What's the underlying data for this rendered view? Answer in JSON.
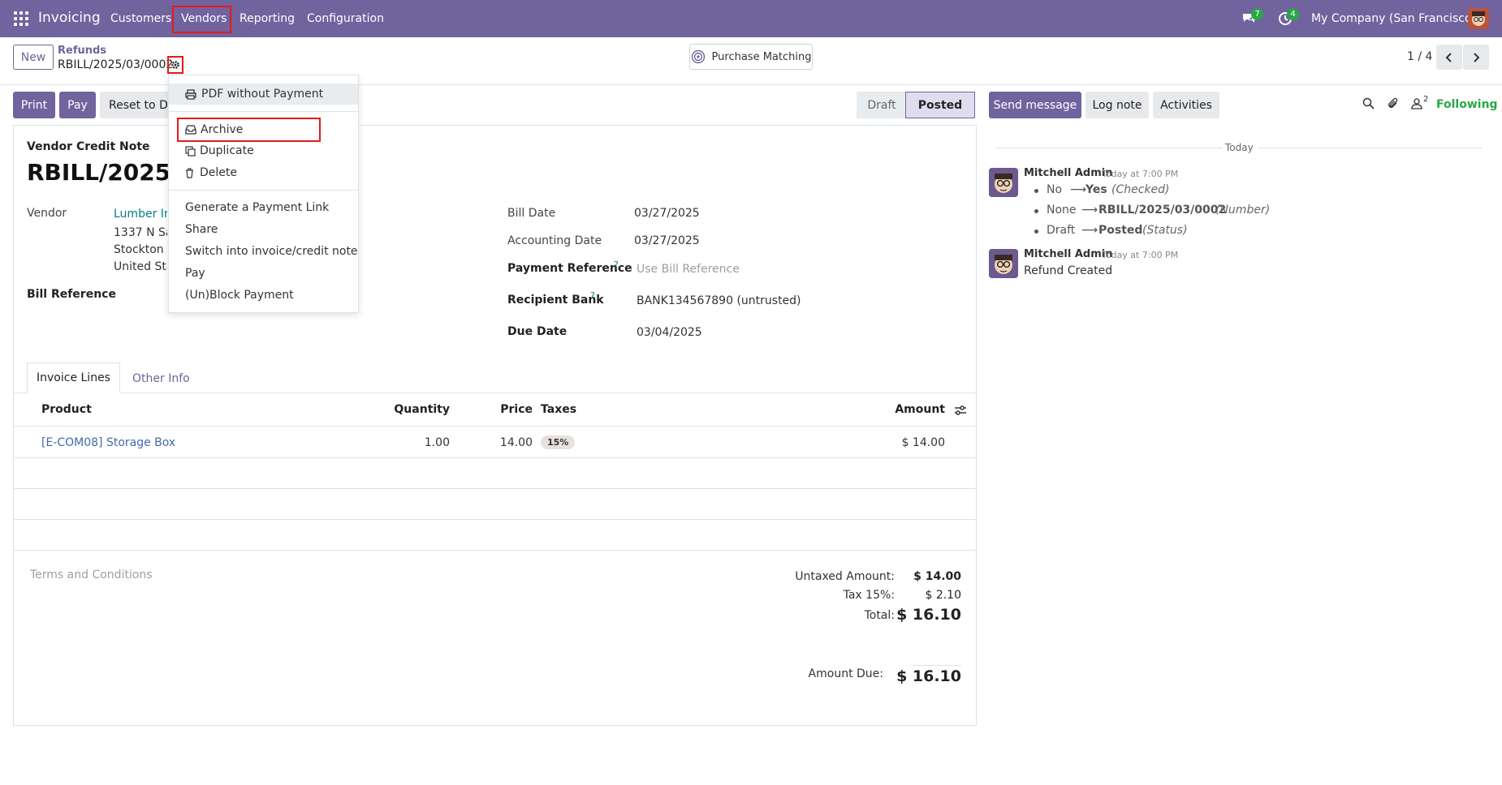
{
  "navbar": {
    "app_name": "Invoicing",
    "menu": [
      "Customers",
      "Vendors",
      "Reporting",
      "Configuration"
    ],
    "messages_count": "7",
    "activities_count": "4",
    "company": "My Company (San Francisco)"
  },
  "control": {
    "new_label": "New",
    "breadcrumb_parent": "Refunds",
    "breadcrumb_current": "RBILL/2025/03/0002",
    "smart_button": "Purchase Matching",
    "pager": "1 / 4"
  },
  "actions": {
    "print": "Print",
    "pay": "Pay",
    "reset": "Reset to Dr"
  },
  "status": {
    "draft": "Draft",
    "posted": "Posted"
  },
  "dropdown": {
    "pdf": "PDF without Payment",
    "archive": "Archive",
    "duplicate": "Duplicate",
    "delete": "Delete",
    "payment_link": "Generate a Payment Link",
    "share": "Share",
    "switch": "Switch into invoice/credit note",
    "pay": "Pay",
    "block": "(Un)Block Payment"
  },
  "form": {
    "doc_type": "Vendor Credit Note",
    "doc_number": "RBILL/2025/03/0",
    "vendor_label": "Vendor",
    "vendor_name": "Lumber Inc",
    "vendor_addr1": "1337 N Sar",
    "vendor_addr2": "Stockton C",
    "vendor_addr3": "United Sta",
    "bill_ref_label": "Bill Reference",
    "bill_date_label": "Bill Date",
    "bill_date": "03/27/2025",
    "acc_date_label": "Accounting Date",
    "acc_date": "03/27/2025",
    "pay_ref_label": "Payment Reference",
    "pay_ref_placeholder": "Use Bill Reference",
    "bank_label": "Recipient Bank",
    "bank": "BANK134567890 (untrusted)",
    "due_label": "Due Date",
    "due_date": "03/04/2025",
    "help": "?"
  },
  "tabs": {
    "lines": "Invoice Lines",
    "other": "Other Info"
  },
  "table": {
    "headers": {
      "product": "Product",
      "quantity": "Quantity",
      "price": "Price",
      "taxes": "Taxes",
      "amount": "Amount"
    },
    "rows": [
      {
        "product": "[E-COM08] Storage Box",
        "quantity": "1.00",
        "price": "14.00",
        "tax": "15%",
        "amount": "$ 14.00"
      }
    ]
  },
  "totals": {
    "terms_placeholder": "Terms and Conditions",
    "untaxed_label": "Untaxed Amount:",
    "untaxed": "$ 14.00",
    "tax_label": "Tax 15%:",
    "tax": "$ 2.10",
    "total_label": "Total:",
    "total": "$ 16.10",
    "due_label": "Amount Due:",
    "due": "$ 16.10"
  },
  "chatter": {
    "send_message": "Send message",
    "log_note": "Log note",
    "activities": "Activities",
    "followers_count": "2",
    "following": "Following",
    "day": "Today",
    "messages": [
      {
        "author": "Mitchell Admin",
        "time": "Today at 7:00 PM",
        "changes": [
          {
            "old": "No",
            "new": "Yes",
            "field": "(Checked)"
          },
          {
            "old": "None",
            "new": "RBILL/2025/03/0002",
            "field": "(Number)"
          },
          {
            "old": "Draft",
            "new": "Posted",
            "field": "(Status)"
          }
        ]
      },
      {
        "author": "Mitchell Admin",
        "time": "Today at 7:00 PM",
        "body": "Refund Created"
      }
    ]
  },
  "colors": {
    "brand": "#71639e",
    "link": "#017e84",
    "highlight": "#e41b1b"
  }
}
